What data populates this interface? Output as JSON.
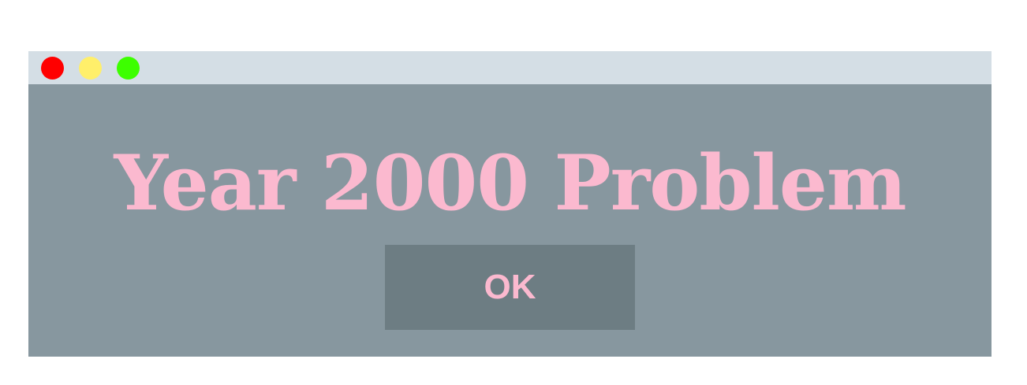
{
  "colors": {
    "window_bg": "#87979f",
    "titlebar_bg": "#d4dee5",
    "text_accent": "#fbb9cf",
    "button_bg": "#6d7d83",
    "close": "#ff0000",
    "minimize": "#ffef6a",
    "maximize": "#3dff00"
  },
  "window": {
    "controls": {
      "close_icon": "close-dot-icon",
      "minimize_icon": "minimize-dot-icon",
      "maximize_icon": "maximize-dot-icon"
    },
    "message": "Year 2000 Problem",
    "ok_label": "OK"
  }
}
